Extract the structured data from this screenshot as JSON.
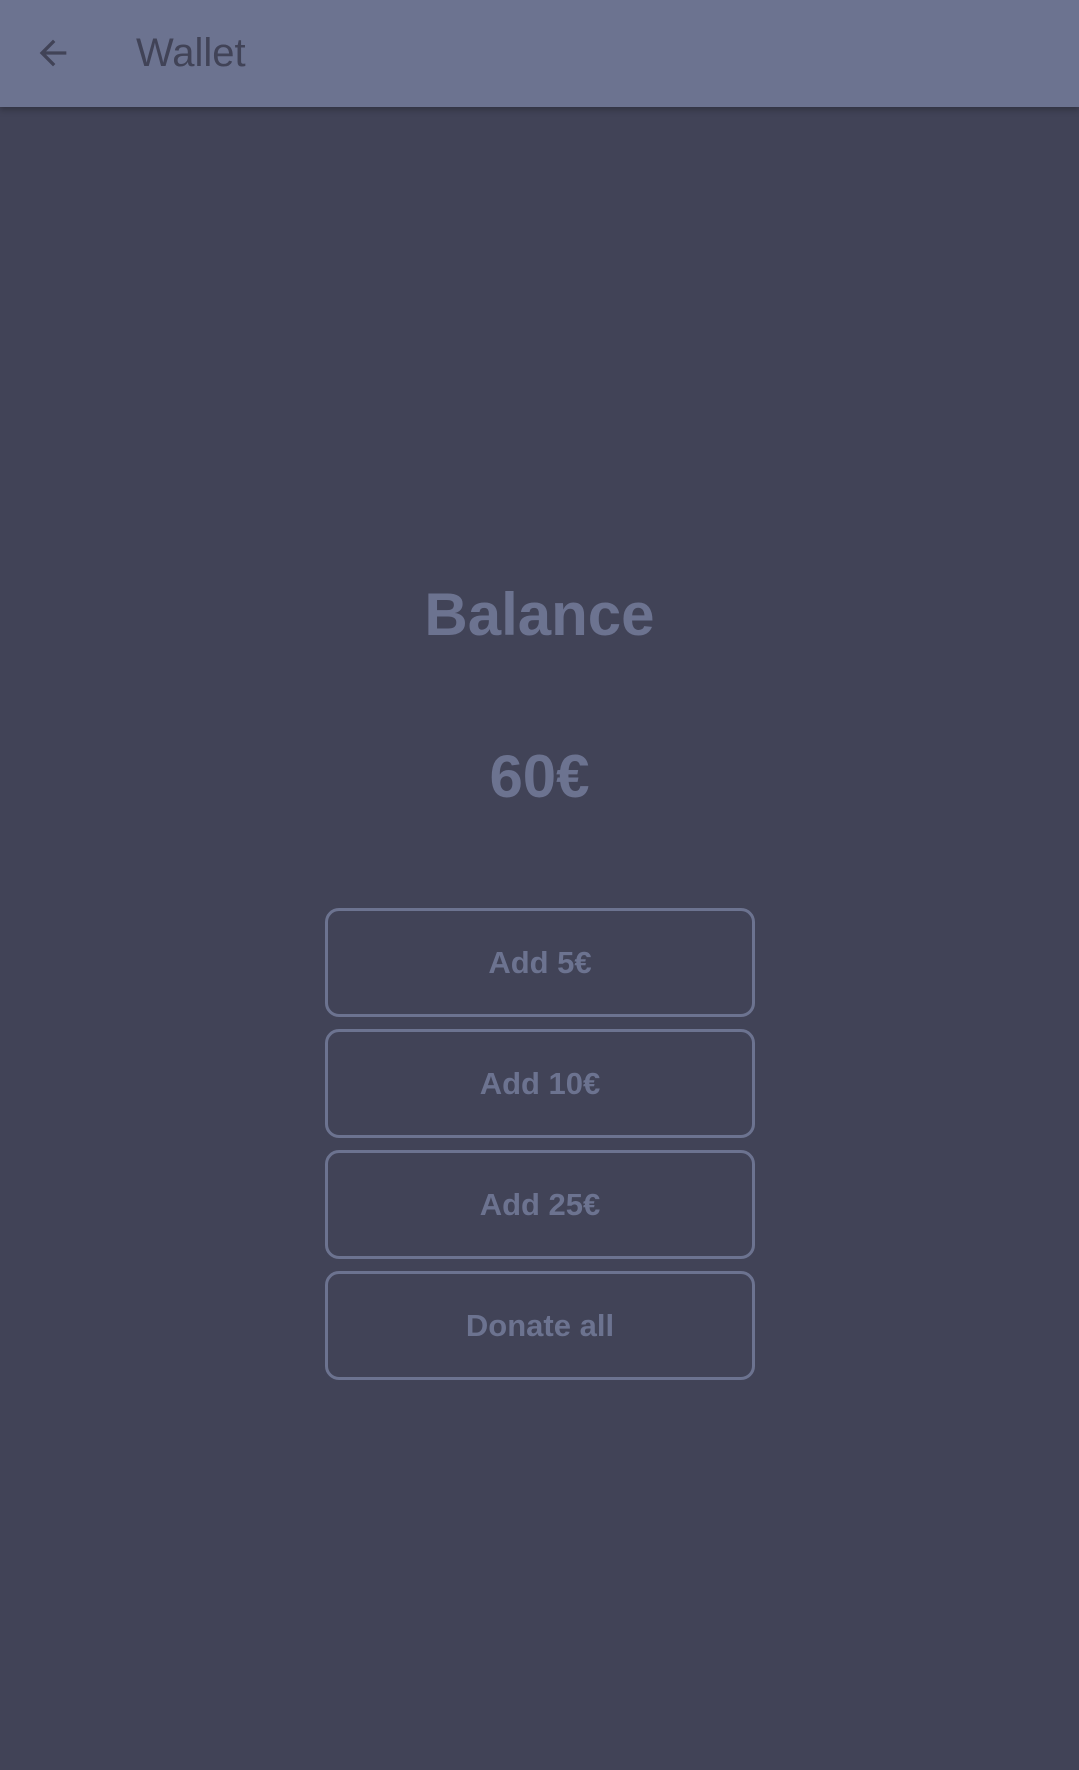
{
  "app_bar": {
    "back_icon": "arrow-left-icon",
    "title": "Wallet"
  },
  "balance": {
    "label": "Balance",
    "amount": "60€"
  },
  "actions": {
    "add_5": "Add 5€",
    "add_10": "Add 10€",
    "add_25": "Add 25€",
    "donate_all": "Donate all"
  },
  "colors": {
    "background": "#414357",
    "app_bar": "#6c7390",
    "accent": "#6c7390"
  }
}
